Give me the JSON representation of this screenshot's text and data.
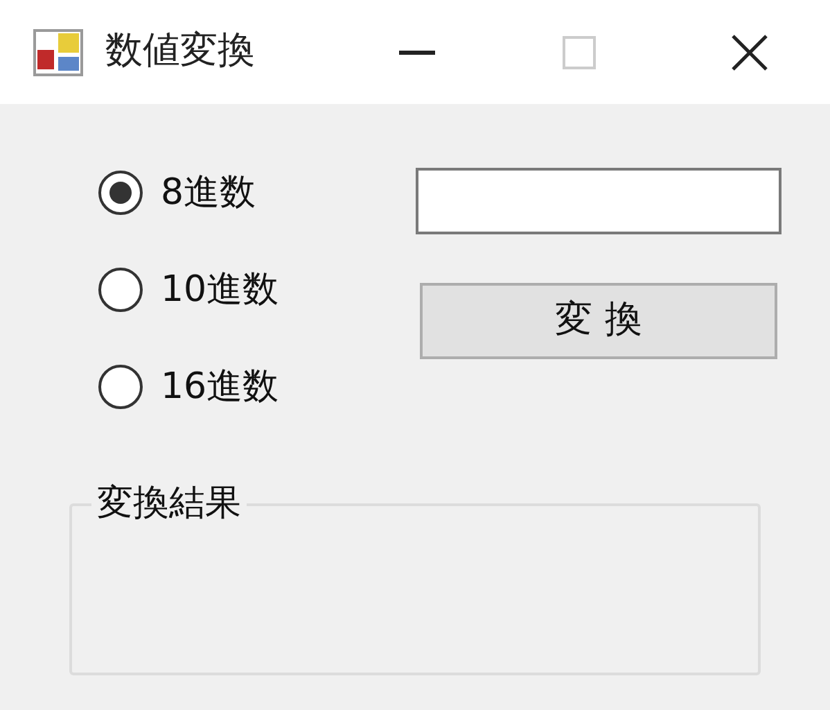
{
  "window": {
    "title": "数値変換",
    "maximize_disabled": true
  },
  "radios": [
    {
      "label": "8進数",
      "selected": true
    },
    {
      "label": "10進数",
      "selected": false
    },
    {
      "label": "16進数",
      "selected": false
    }
  ],
  "convert_button": {
    "label": "変 換"
  },
  "result_group": {
    "label": "変換結果"
  }
}
